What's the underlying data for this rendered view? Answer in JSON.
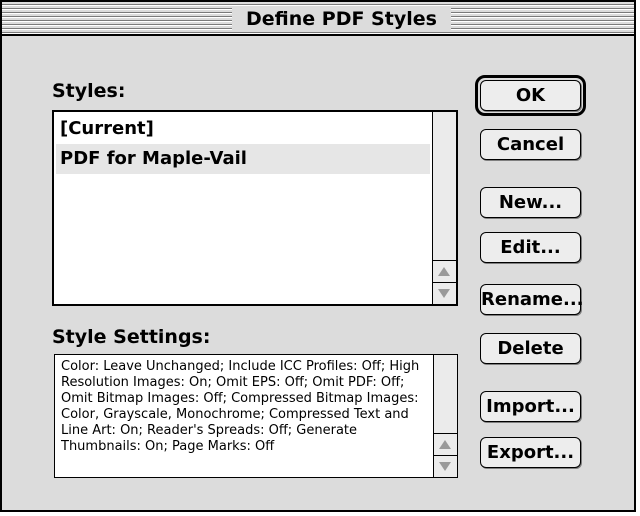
{
  "window": {
    "title": "Define PDF Styles"
  },
  "styles": {
    "label": "Styles:",
    "items": [
      {
        "label": "[Current]"
      },
      {
        "label": "PDF for Maple-Vail"
      }
    ]
  },
  "settings": {
    "label": "Style Settings:",
    "text": "Color: Leave Unchanged; Include ICC Profiles: Off; High Resolution Images: On; Omit EPS: Off; Omit PDF: Off; Omit Bitmap Images: Off; Compressed Bitmap Images: Color, Grayscale, Monochrome; Compressed Text and Line Art: On; Reader's Spreads: Off; Generate Thumbnails: On; Page Marks: Off"
  },
  "buttons": {
    "ok": "OK",
    "cancel": "Cancel",
    "new": "New...",
    "edit": "Edit...",
    "rename": "Rename...",
    "delete": "Delete",
    "import": "Import...",
    "export": "Export..."
  },
  "colors": {
    "window_bg": "#dcdcdc",
    "selected_row": "#e6e6e6"
  }
}
